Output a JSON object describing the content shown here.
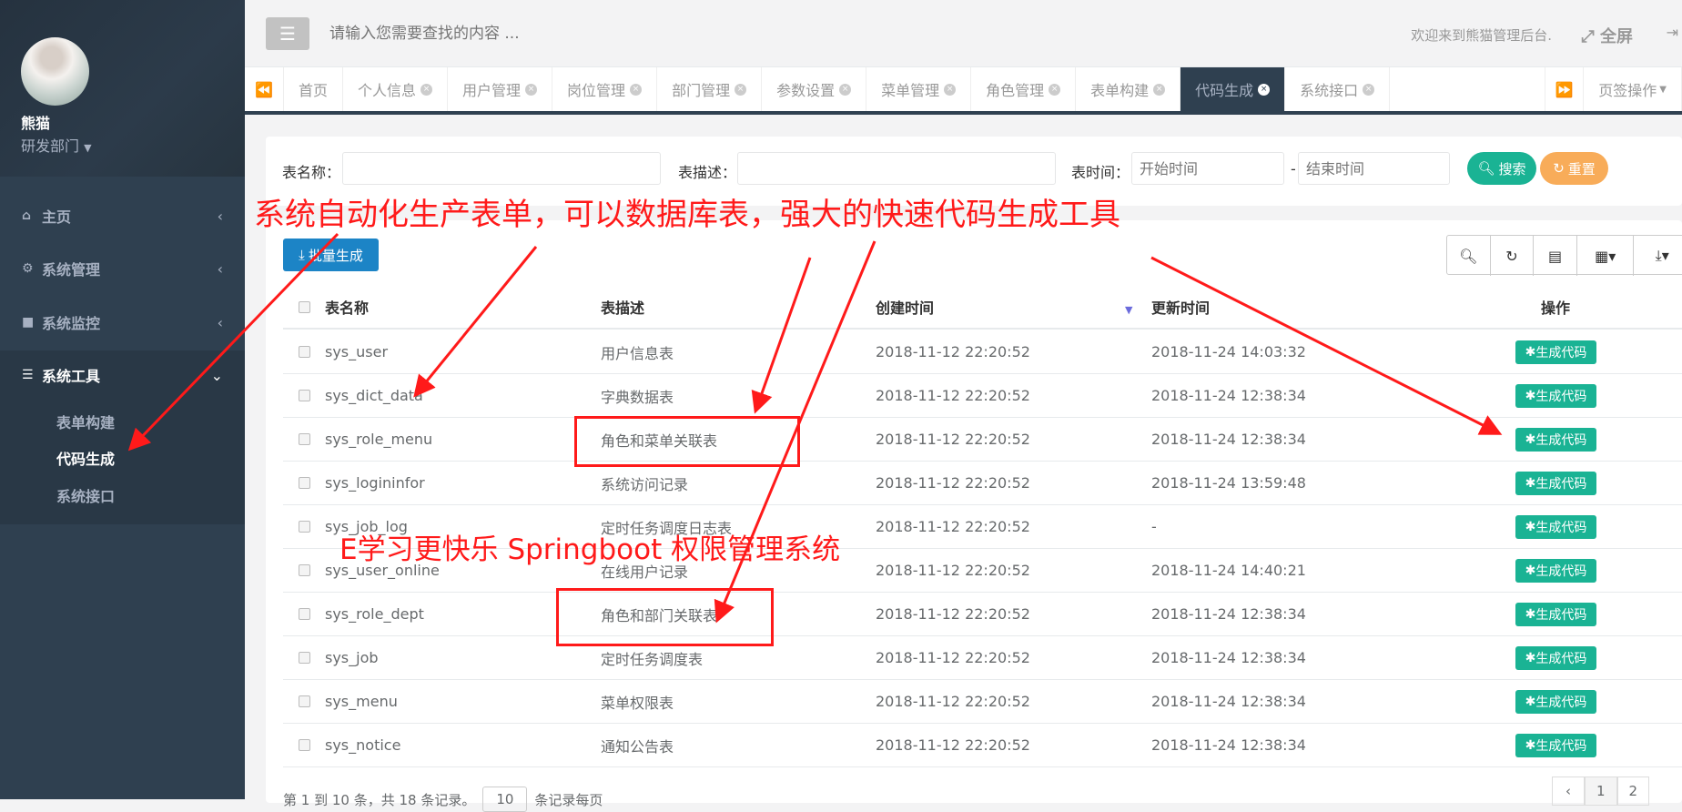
{
  "sidebar": {
    "user_name": "熊猫",
    "department": "研发部门",
    "menu": [
      {
        "label": "主页",
        "icon": "home-icon"
      },
      {
        "label": "系统管理",
        "icon": "gear-icon"
      },
      {
        "label": "系统监控",
        "icon": "video-icon"
      },
      {
        "label": "系统工具",
        "icon": "bars-icon"
      }
    ],
    "submenu": [
      "表单构建",
      "代码生成",
      "系统接口"
    ]
  },
  "header": {
    "search_placeholder": "请输入您需要查找的内容 ...",
    "welcome": "欢迎来到熊猫管理后台.",
    "fullscreen": "全屏"
  },
  "tabs": [
    "首页",
    "个人信息",
    "用户管理",
    "岗位管理",
    "部门管理",
    "参数设置",
    "菜单管理",
    "角色管理",
    "表单构建",
    "代码生成",
    "系统接口"
  ],
  "active_tab": "代码生成",
  "tab_ops": "页签操作",
  "filters": {
    "table_name_label": "表名称：",
    "table_desc_label": "表描述：",
    "time_label": "表时间：",
    "start_placeholder": "开始时间",
    "end_placeholder": "结束时间",
    "dash": "-",
    "search": "搜索",
    "reset": "重置"
  },
  "batch_button": "批量生成",
  "table": {
    "headers": [
      "表名称",
      "表描述",
      "创建时间",
      "更新时间",
      "操作"
    ],
    "action_label": "生成代码",
    "rows": [
      [
        "sys_user",
        "用户信息表",
        "2018-11-12 22:20:52",
        "2018-11-24 14:03:32"
      ],
      [
        "sys_dict_data",
        "字典数据表",
        "2018-11-12 22:20:52",
        "2018-11-24 12:38:34"
      ],
      [
        "sys_role_menu",
        "角色和菜单关联表",
        "2018-11-12 22:20:52",
        "2018-11-24 12:38:34"
      ],
      [
        "sys_logininfor",
        "系统访问记录",
        "2018-11-12 22:20:52",
        "2018-11-24 13:59:48"
      ],
      [
        "sys_job_log",
        "定时任务调度日志表",
        "2018-11-12 22:20:52",
        "-"
      ],
      [
        "sys_user_online",
        "在线用户记录",
        "2018-11-12 22:20:52",
        "2018-11-24 14:40:21"
      ],
      [
        "sys_role_dept",
        "角色和部门关联表",
        "2018-11-12 22:20:52",
        "2018-11-24 12:38:34"
      ],
      [
        "sys_job",
        "定时任务调度表",
        "2018-11-12 22:20:52",
        "2018-11-24 12:38:34"
      ],
      [
        "sys_menu",
        "菜单权限表",
        "2018-11-12 22:20:52",
        "2018-11-24 12:38:34"
      ],
      [
        "sys_notice",
        "通知公告表",
        "2018-11-12 22:20:52",
        "2018-11-24 12:38:34"
      ]
    ]
  },
  "pagination": {
    "summary": "第 1 到 10 条，共 18 条记录。",
    "page_size": "10",
    "per_page_label": "条记录每页",
    "pages": [
      "‹",
      "1",
      "2"
    ]
  },
  "annotations": {
    "headline": "系统自动化生产表单，可以数据库表，强大的快速代码生成工具",
    "watermark": "E学习更快乐  Springboot 权限管理系统"
  },
  "colors": {
    "green": "#1ab394",
    "orange": "#f8ac59",
    "blue": "#1c84c6",
    "sidebar": "#2f4050",
    "annotation": "#ff1a1a"
  }
}
